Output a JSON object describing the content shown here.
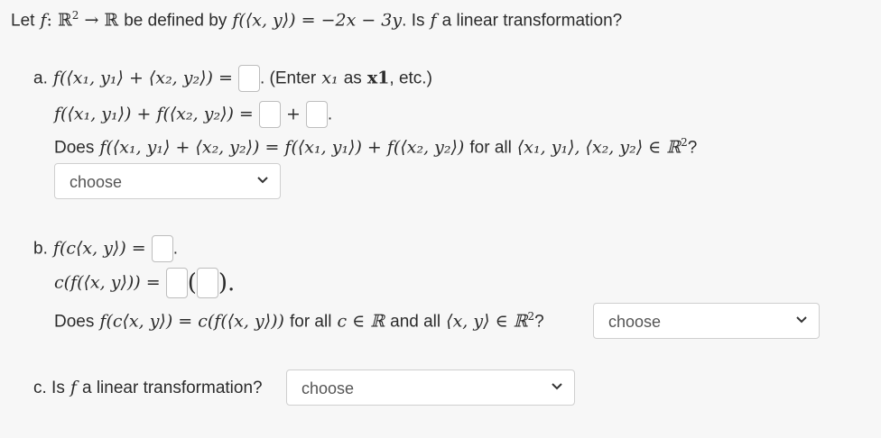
{
  "q": {
    "intro_prefix": "Let",
    "intro_mid": "be defined by",
    "intro_q": ". Is",
    "intro_end": "a linear transformation?",
    "f": "f",
    "map": ": ℝ",
    "map_end": "→ ℝ",
    "def": "f(⟨x, y⟩) = −2x − 3y"
  },
  "part_a": {
    "label": "a.",
    "expr1": "f(⟨x₁, y₁⟩ + ⟨x₂, y₂⟩) =",
    "hint": ". (Enter",
    "hint_var": "x₁",
    "hint_mid": "as",
    "hint_code": "x1",
    "hint_end": ", etc.)",
    "expr2": "f(⟨x₁, y₁⟩) + f(⟨x₂, y₂⟩) =",
    "plus": "+",
    "dot": ".",
    "does": "Does",
    "does_expr": "f(⟨x₁, y₁⟩ + ⟨x₂, y₂⟩) = f(⟨x₁, y₁⟩) + f(⟨x₂, y₂⟩)",
    "for_all": "for all",
    "forall_expr": "⟨x₁, y₁⟩, ⟨x₂, y₂⟩ ∈ ℝ",
    "qmark": "?",
    "select_value": "choose"
  },
  "part_b": {
    "label": "b.",
    "expr1": "f(c⟨x, y⟩) =",
    "dot": ".",
    "expr2": "c(f(⟨x, y⟩)) =",
    "paren_open": "(",
    "paren_close": ").",
    "does": "Does",
    "does_expr": "f(c⟨x, y⟩) = c(f(⟨x, y⟩))",
    "for_all_c": "for all",
    "c_expr": "c ∈ ℝ",
    "and_all": "and all",
    "xy_expr": "⟨x, y⟩ ∈ ℝ",
    "qmark": "?",
    "select_value": "choose"
  },
  "part_c": {
    "label": "c. Is",
    "f": "f",
    "rest": "a linear transformation?",
    "select_value": "choose"
  }
}
